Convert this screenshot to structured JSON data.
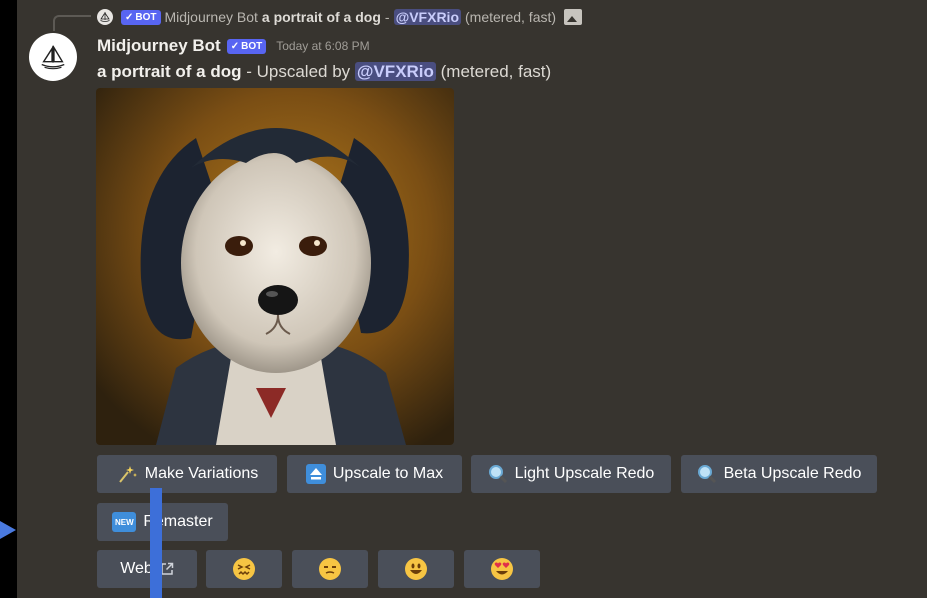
{
  "reply": {
    "bot_name": "Midjourney Bot",
    "bot_tag": "BOT",
    "prompt": "a portrait of a dog",
    "separator": " - ",
    "mention": "@VFXRio",
    "suffix": "(metered, fast)",
    "icon": "image-icon"
  },
  "message": {
    "username": "Midjourney Bot",
    "bot_tag": "BOT",
    "timestamp": "Today at 6:08 PM",
    "prompt": "a portrait of a dog",
    "upscaled_by": " - Upscaled by ",
    "mention": "@VFXRio",
    "suffix": " (metered, fast)"
  },
  "buttons": {
    "make_variations": "Make Variations",
    "upscale_to_max": "Upscale to Max",
    "light_upscale_redo": "Light Upscale Redo",
    "beta_upscale_redo": "Beta Upscale Redo",
    "remaster_new_badge": "NEW",
    "remaster": "Remaster",
    "web": "Web"
  },
  "reactions": [
    "confounded-face-icon",
    "unamused-face-icon",
    "grinning-face-icon",
    "heart-eyes-face-icon"
  ],
  "colors": {
    "background": "#37342f",
    "button": "#4a4f59",
    "bot_tag": "#5865f2",
    "mention_bg": "#4a4e80",
    "cursor": "#3d6fd9"
  }
}
